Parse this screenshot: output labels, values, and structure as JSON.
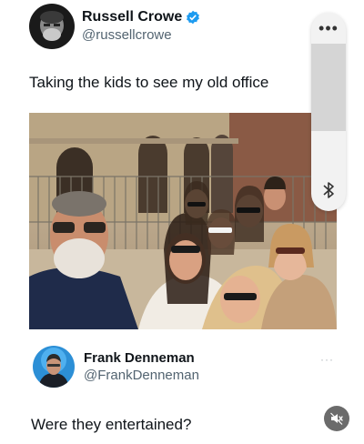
{
  "post": {
    "author_name": "Russell Crowe",
    "author_handle": "@russellcrowe",
    "text": "Taking the kids to see my old office",
    "verified_color": "#1d9bf0"
  },
  "side_panel": {
    "menu_icon": "more-dots-icon",
    "bottom_icon": "bluetooth-icon"
  },
  "reply": {
    "author_name": "Frank Denneman",
    "author_handle": "@FrankDenneman",
    "text": "Were they entertained?",
    "more_icon": "more-dots-icon"
  },
  "controls": {
    "mute_icon": "speaker-muted-icon"
  }
}
